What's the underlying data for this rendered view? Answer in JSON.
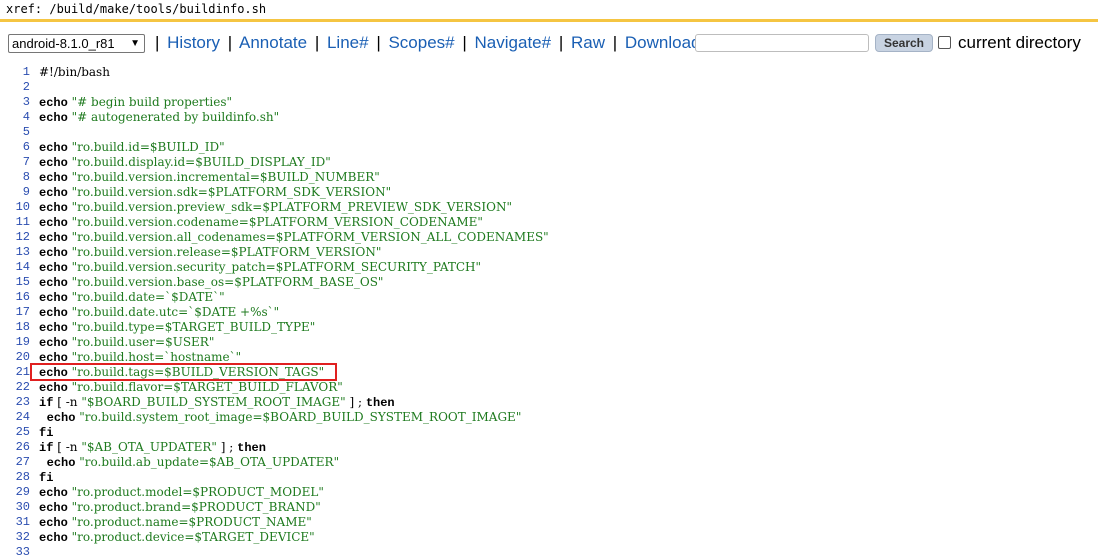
{
  "xref": {
    "label": "xref:",
    "path": "/build/make/tools/buildinfo.sh"
  },
  "toolbar": {
    "version": "android-8.1.0_r81",
    "links": [
      "History",
      "Annotate",
      "Line#",
      "Scopes#",
      "Navigate#",
      "Raw",
      "Download"
    ],
    "search_label": "Search",
    "current_directory_label": "current directory",
    "current_directory_checked": false
  },
  "highlight": {
    "line": 21,
    "color": "#e02020"
  },
  "colors": {
    "accent_bar": "#f5c542",
    "link": "#1a5fb4",
    "string": "#1e7a1e",
    "line_number": "#2a4db0"
  },
  "code": [
    {
      "n": "1",
      "segs": [
        {
          "t": "#!/bin/bash",
          "c": "plain"
        }
      ]
    },
    {
      "n": "2",
      "segs": []
    },
    {
      "n": "3",
      "segs": [
        {
          "t": "echo",
          "c": "kw"
        },
        {
          "t": " \"# begin build properties\"",
          "c": "str"
        }
      ]
    },
    {
      "n": "4",
      "segs": [
        {
          "t": "echo",
          "c": "kw"
        },
        {
          "t": " \"# autogenerated by buildinfo.sh\"",
          "c": "str"
        }
      ]
    },
    {
      "n": "5",
      "segs": []
    },
    {
      "n": "6",
      "segs": [
        {
          "t": "echo",
          "c": "kw"
        },
        {
          "t": " \"ro.build.id=$BUILD_ID\"",
          "c": "str"
        }
      ]
    },
    {
      "n": "7",
      "segs": [
        {
          "t": "echo",
          "c": "kw"
        },
        {
          "t": " \"ro.build.display.id=$BUILD_DISPLAY_ID\"",
          "c": "str"
        }
      ]
    },
    {
      "n": "8",
      "segs": [
        {
          "t": "echo",
          "c": "kw"
        },
        {
          "t": " \"ro.build.version.incremental=$BUILD_NUMBER\"",
          "c": "str"
        }
      ]
    },
    {
      "n": "9",
      "segs": [
        {
          "t": "echo",
          "c": "kw"
        },
        {
          "t": " \"ro.build.version.sdk=$PLATFORM_SDK_VERSION\"",
          "c": "str"
        }
      ]
    },
    {
      "n": "10",
      "segs": [
        {
          "t": "echo",
          "c": "kw"
        },
        {
          "t": " \"ro.build.version.preview_sdk=$PLATFORM_PREVIEW_SDK_VERSION\"",
          "c": "str"
        }
      ]
    },
    {
      "n": "11",
      "segs": [
        {
          "t": "echo",
          "c": "kw"
        },
        {
          "t": " \"ro.build.version.codename=$PLATFORM_VERSION_CODENAME\"",
          "c": "str"
        }
      ]
    },
    {
      "n": "12",
      "segs": [
        {
          "t": "echo",
          "c": "kw"
        },
        {
          "t": " \"ro.build.version.all_codenames=$PLATFORM_VERSION_ALL_CODENAMES\"",
          "c": "str"
        }
      ]
    },
    {
      "n": "13",
      "segs": [
        {
          "t": "echo",
          "c": "kw"
        },
        {
          "t": " \"ro.build.version.release=$PLATFORM_VERSION\"",
          "c": "str"
        }
      ]
    },
    {
      "n": "14",
      "segs": [
        {
          "t": "echo",
          "c": "kw"
        },
        {
          "t": " \"ro.build.version.security_patch=$PLATFORM_SECURITY_PATCH\"",
          "c": "str"
        }
      ]
    },
    {
      "n": "15",
      "segs": [
        {
          "t": "echo",
          "c": "kw"
        },
        {
          "t": " \"ro.build.version.base_os=$PLATFORM_BASE_OS\"",
          "c": "str"
        }
      ]
    },
    {
      "n": "16",
      "segs": [
        {
          "t": "echo",
          "c": "kw"
        },
        {
          "t": " \"ro.build.date=`$DATE`\"",
          "c": "str"
        }
      ]
    },
    {
      "n": "17",
      "segs": [
        {
          "t": "echo",
          "c": "kw"
        },
        {
          "t": " \"ro.build.date.utc=`$DATE +%s`\"",
          "c": "str"
        }
      ]
    },
    {
      "n": "18",
      "segs": [
        {
          "t": "echo",
          "c": "kw"
        },
        {
          "t": " \"ro.build.type=$TARGET_BUILD_TYPE\"",
          "c": "str"
        }
      ]
    },
    {
      "n": "19",
      "segs": [
        {
          "t": "echo",
          "c": "kw"
        },
        {
          "t": " \"ro.build.user=$USER\"",
          "c": "str"
        }
      ]
    },
    {
      "n": "20",
      "segs": [
        {
          "t": "echo",
          "c": "kw"
        },
        {
          "t": " \"ro.build.host=`hostname`\"",
          "c": "str"
        }
      ]
    },
    {
      "n": "21",
      "segs": [
        {
          "t": "echo",
          "c": "kw"
        },
        {
          "t": " \"ro.build.tags=$BUILD_VERSION_TAGS\"",
          "c": "str"
        }
      ]
    },
    {
      "n": "22",
      "segs": [
        {
          "t": "echo",
          "c": "kw"
        },
        {
          "t": " \"ro.build.flavor=$TARGET_BUILD_FLAVOR\"",
          "c": "str"
        }
      ]
    },
    {
      "n": "23",
      "segs": [
        {
          "t": "if",
          "c": "kw"
        },
        {
          "t": " [ -n ",
          "c": "plain"
        },
        {
          "t": "\"$BOARD_BUILD_SYSTEM_ROOT_IMAGE\"",
          "c": "str"
        },
        {
          "t": " ] ; ",
          "c": "plain"
        },
        {
          "t": "then",
          "c": "kw"
        }
      ]
    },
    {
      "n": "24",
      "segs": [
        {
          "t": "  ",
          "c": "plain"
        },
        {
          "t": "echo",
          "c": "kw"
        },
        {
          "t": " \"ro.build.system_root_image=$BOARD_BUILD_SYSTEM_ROOT_IMAGE\"",
          "c": "str"
        }
      ]
    },
    {
      "n": "25",
      "segs": [
        {
          "t": "fi",
          "c": "kw"
        }
      ]
    },
    {
      "n": "26",
      "segs": [
        {
          "t": "if",
          "c": "kw"
        },
        {
          "t": " [ -n ",
          "c": "plain"
        },
        {
          "t": "\"$AB_OTA_UPDATER\"",
          "c": "str"
        },
        {
          "t": " ] ; ",
          "c": "plain"
        },
        {
          "t": "then",
          "c": "kw"
        }
      ]
    },
    {
      "n": "27",
      "segs": [
        {
          "t": "  ",
          "c": "plain"
        },
        {
          "t": "echo",
          "c": "kw"
        },
        {
          "t": " \"ro.build.ab_update=$AB_OTA_UPDATER\"",
          "c": "str"
        }
      ]
    },
    {
      "n": "28",
      "segs": [
        {
          "t": "fi",
          "c": "kw"
        }
      ]
    },
    {
      "n": "29",
      "segs": [
        {
          "t": "echo",
          "c": "kw"
        },
        {
          "t": " \"ro.product.model=$PRODUCT_MODEL\"",
          "c": "str"
        }
      ]
    },
    {
      "n": "30",
      "segs": [
        {
          "t": "echo",
          "c": "kw"
        },
        {
          "t": " \"ro.product.brand=$PRODUCT_BRAND\"",
          "c": "str"
        }
      ]
    },
    {
      "n": "31",
      "segs": [
        {
          "t": "echo",
          "c": "kw"
        },
        {
          "t": " \"ro.product.name=$PRODUCT_NAME\"",
          "c": "str"
        }
      ]
    },
    {
      "n": "32",
      "segs": [
        {
          "t": "echo",
          "c": "kw"
        },
        {
          "t": " \"ro.product.device=$TARGET_DEVICE\"",
          "c": "str"
        }
      ]
    },
    {
      "n": "33",
      "segs": []
    }
  ]
}
